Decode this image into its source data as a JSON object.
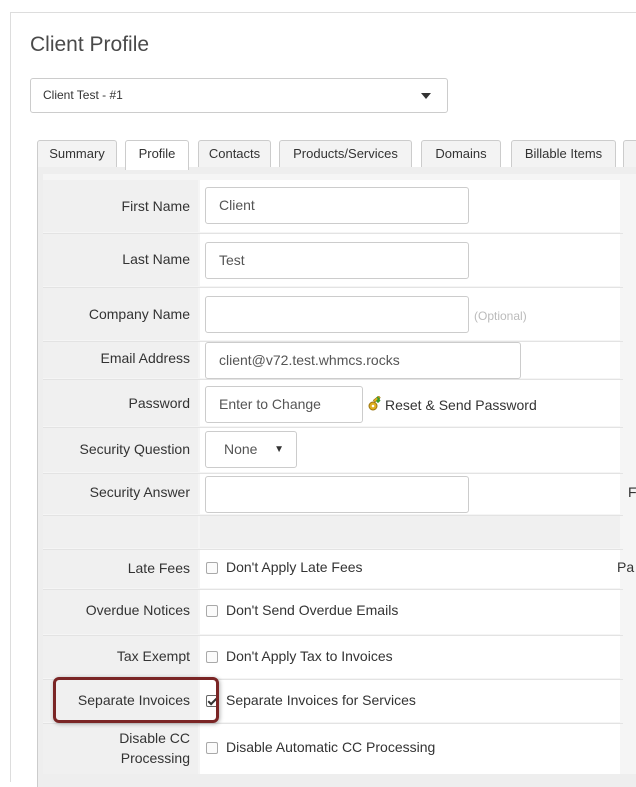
{
  "page": {
    "title": "Client Profile",
    "client_select_value": "Client Test - #1"
  },
  "tabs": [
    {
      "label": "Summary"
    },
    {
      "label": "Profile",
      "active": true
    },
    {
      "label": "Contacts"
    },
    {
      "label": "Products/Services"
    },
    {
      "label": "Domains"
    },
    {
      "label": "Billable Items"
    }
  ],
  "form": {
    "first_name": {
      "label": "First Name",
      "value": "Client"
    },
    "last_name": {
      "label": "Last Name",
      "value": "Test"
    },
    "company_name": {
      "label": "Company Name",
      "value": "",
      "optional": "(Optional)"
    },
    "email": {
      "label": "Email Address",
      "value": "client@v72.test.whmcs.rocks"
    },
    "password": {
      "label": "Password",
      "placeholder": "Enter to Change",
      "reset_label": "Reset & Send Password"
    },
    "security_question": {
      "label": "Security Question",
      "value": "None"
    },
    "security_answer": {
      "label": "Security Answer",
      "value": ""
    },
    "late_fees": {
      "label": "Late Fees",
      "checkbox_label": "Don't Apply Late Fees",
      "checked": false
    },
    "overdue_notices": {
      "label": "Overdue Notices",
      "checkbox_label": "Don't Send Overdue Emails",
      "checked": false
    },
    "tax_exempt": {
      "label": "Tax Exempt",
      "checkbox_label": "Don't Apply Tax to Invoices",
      "checked": false
    },
    "separate_invoices": {
      "label": "Separate Invoices",
      "checkbox_label": "Separate Invoices for Services",
      "checked": true
    },
    "disable_cc_line1": "Disable CC",
    "disable_cc_line2": "Processing",
    "disable_cc_checkbox_label": "Disable Automatic CC Processing"
  },
  "right_column_cutoff": {
    "row_security_answer": "F",
    "row_late_fees": "Pa"
  },
  "colors": {
    "highlight_border": "#7a2525",
    "label_background": "#f0f0f0"
  }
}
